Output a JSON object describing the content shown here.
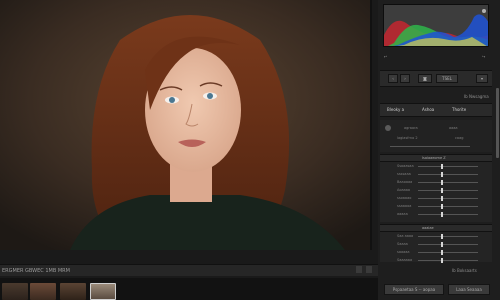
{
  "status_bar": {
    "text": "ERGMER GBWEC 1MB MRM"
  },
  "panel": {
    "top_header": "Ib Nwsagma",
    "tabs": [
      "Bleoky a",
      "Ashoa",
      "Thorite"
    ],
    "row_top_left": "agraora",
    "row_top_mid": "aaaa",
    "row_top_sub": "lagiasfrno 2",
    "row_top_sub2": "caag",
    "section1_title": "Isaiaaeome Z",
    "section1_labels": [
      "Ssoaasaa",
      "ssssaaa",
      "Baaoaaa",
      "Aoaaaa",
      "ssoaaao",
      "ssaaaoa",
      "aaaaa"
    ],
    "section2_title": "aaaiae",
    "section2_labels": [
      "Saa aaaa",
      "Saaaa",
      "saaaaa",
      "Saaaaaa"
    ],
    "footer_count": "Ib Boksaarts",
    "button_left": "Pspaaetaa S -- aopaa",
    "button_right": "Laaa Seaaaa"
  },
  "toolbar_labels": {
    "mid": "TSEL"
  },
  "colors": {
    "accent": "#3d3d3d",
    "panel": "#1e1e1e"
  },
  "icons": [
    "undo-icon",
    "redo-icon",
    "prev-icon",
    "next-icon",
    "camera-icon",
    "chevron-icon"
  ]
}
